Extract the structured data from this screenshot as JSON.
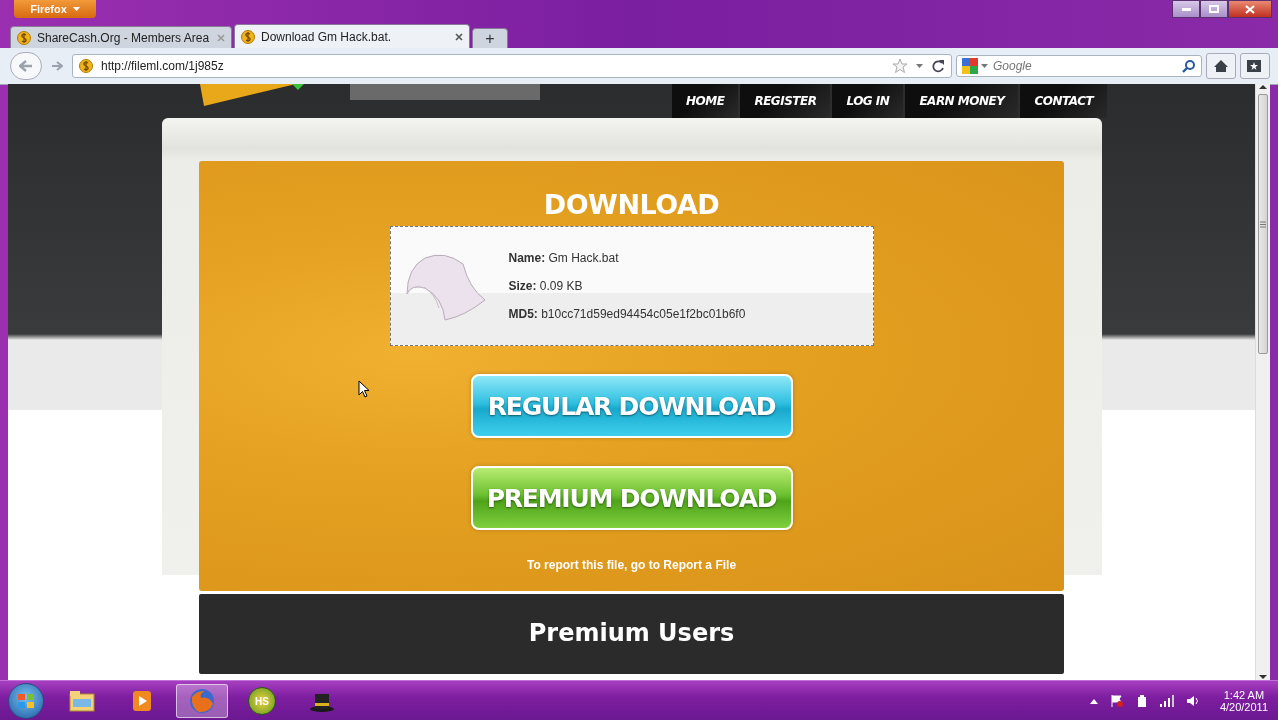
{
  "browser": {
    "menu_button": "Firefox",
    "tabs": [
      {
        "title": "ShareCash.Org - Members Area",
        "selected": false
      },
      {
        "title": "Download Gm Hack.bat.",
        "selected": true
      }
    ],
    "new_tab": "+",
    "address": "http://fileml.com/1j985z",
    "search": {
      "placeholder": "Google"
    }
  },
  "site": {
    "nav": [
      "HOME",
      "REGISTER",
      "LOG IN",
      "EARN MONEY",
      "CONTACT"
    ],
    "download": {
      "title": "DOWNLOAD",
      "fields": [
        {
          "label": "Name:",
          "value": "Gm Hack.bat"
        },
        {
          "label": "Size:",
          "value": "0.09 KB"
        },
        {
          "label": "MD5:",
          "value": "b10cc71d59ed94454c05e1f2bc01b6f0"
        }
      ],
      "buttons": [
        {
          "kind": "regular",
          "label": "REGULAR DOWNLOAD"
        },
        {
          "kind": "premium",
          "label": "PREMIUM DOWNLOAD"
        }
      ],
      "report": "To report this file, go to Report a File"
    },
    "premium_users": {
      "title": "Premium Users"
    }
  },
  "taskbar": {
    "apps": [
      {
        "kind": "folder"
      },
      {
        "kind": "media"
      },
      {
        "kind": "browser",
        "selected": true
      },
      {
        "kind": "badge",
        "label": "HS"
      },
      {
        "kind": "hat"
      }
    ],
    "clock": {
      "time": "1:42 AM",
      "date": "4/20/2011"
    }
  }
}
